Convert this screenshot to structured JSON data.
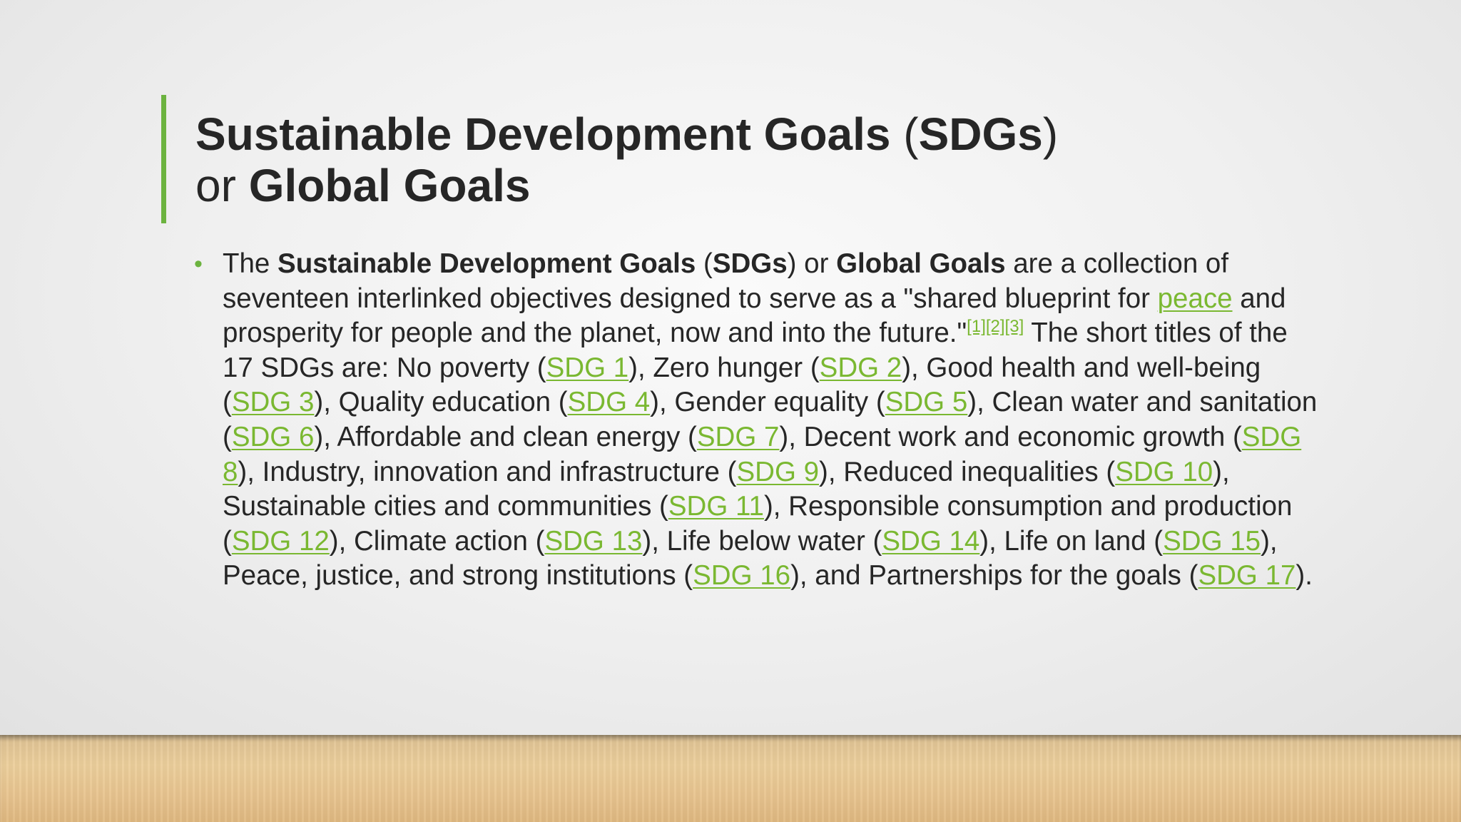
{
  "slide": {
    "title": {
      "line1_bold": "Sustainable Development Goals",
      "line1_open": " (",
      "line1_bold2": "SDGs",
      "line1_close": ")",
      "line2_plain": "or ",
      "line2_bold": "Global Goals"
    },
    "bullet": {
      "marker": "•",
      "t01": "The ",
      "b01": "Sustainable Development Goals",
      "t02": " (",
      "b02": "SDGs",
      "t03": ") or ",
      "b03": "Global Goals",
      "t04": " are a collection of seventeen interlinked objectives designed to serve as a \"shared blueprint for ",
      "link_peace": "peace",
      "t05": " and prosperity for people and the planet, now and into the future.\"",
      "cite1": "[1]",
      "cite2": "[2]",
      "cite3": "[3]",
      "t06": " The short titles of the 17 SDGs are: No poverty (",
      "sdg1": "SDG 1",
      "t07": "), Zero hunger (",
      "sdg2": "SDG 2",
      "t08": "), Good health and well-being (",
      "sdg3": "SDG 3",
      "t09": "), Quality education (",
      "sdg4": "SDG 4",
      "t10": "), Gender equality (",
      "sdg5": "SDG 5",
      "t11": "), Clean water and sanitation (",
      "sdg6": "SDG 6",
      "t12": "), Affordable and clean energy (",
      "sdg7": "SDG 7",
      "t13": "), Decent work and economic growth (",
      "sdg8": "SDG 8",
      "t14": "), Industry, innovation and infrastructure (",
      "sdg9": "SDG 9",
      "t15": "), Reduced inequalities (",
      "sdg10": "SDG 10",
      "t16": "), Sustainable cities and communities (",
      "sdg11": "SDG 11",
      "t17": "), Responsible consumption and production (",
      "sdg12": "SDG 12",
      "t18": "), Climate action (",
      "sdg13": "SDG 13",
      "t19": "), Life below water (",
      "sdg14": "SDG 14",
      "t20": "), Life on land (",
      "sdg15": "SDG 15",
      "t21": "), Peace, justice, and strong institutions (",
      "sdg16": "SDG 16",
      "t22": "), and Partnerships for the goals (",
      "sdg17": "SDG 17",
      "t23": ")."
    }
  },
  "colors": {
    "accent": "#6cb33f",
    "link": "#7ab831",
    "text": "#262626"
  }
}
